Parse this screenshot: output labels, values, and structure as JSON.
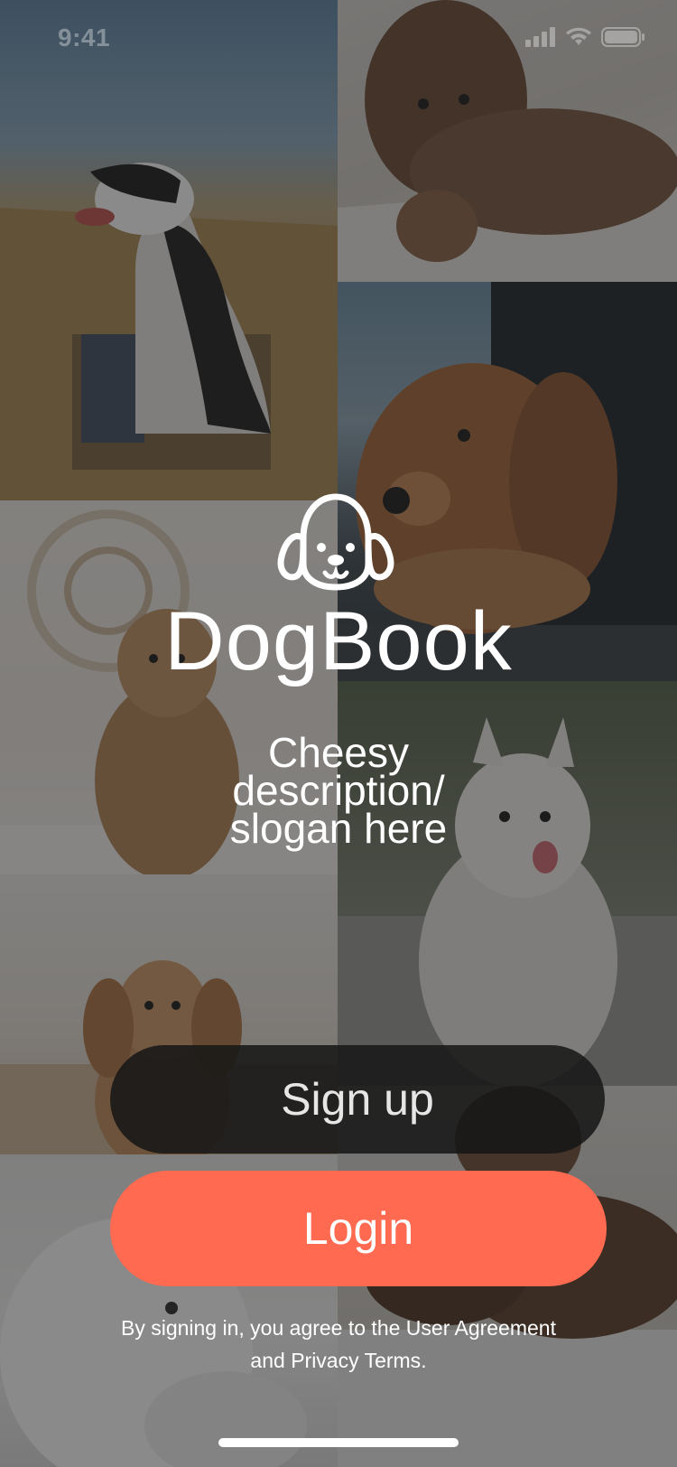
{
  "status_bar": {
    "time": "9:41",
    "icons": [
      "signal-icon",
      "wifi-icon",
      "battery-icon"
    ]
  },
  "background_photos": [
    "dog-photo-border-collie",
    "dog-photo-curly-brown",
    "dog-photo-spaniel-car",
    "dog-photo-golden-doodle",
    "dog-photo-samoyed",
    "dog-photo-cocker-spaniel",
    "dog-photo-white-fluffy",
    "dog-photo-sleeping-dog"
  ],
  "brand": {
    "logo_icon": "dog-face-icon",
    "title": "DogBook",
    "slogan_line1": "Cheesy",
    "slogan_line2": "description/",
    "slogan_line3": "slogan here"
  },
  "actions": {
    "signup_label": "Sign up",
    "login_label": "Login"
  },
  "legal": {
    "prefix": "By signing in, you agree to the ",
    "agreement_link": "User Agreement",
    "middle": "and ",
    "privacy_link": "Privacy Terms",
    "suffix": "."
  },
  "colors": {
    "accent": "#FF6A50",
    "signup_bg": "#161616",
    "text": "#FFFFFF"
  }
}
